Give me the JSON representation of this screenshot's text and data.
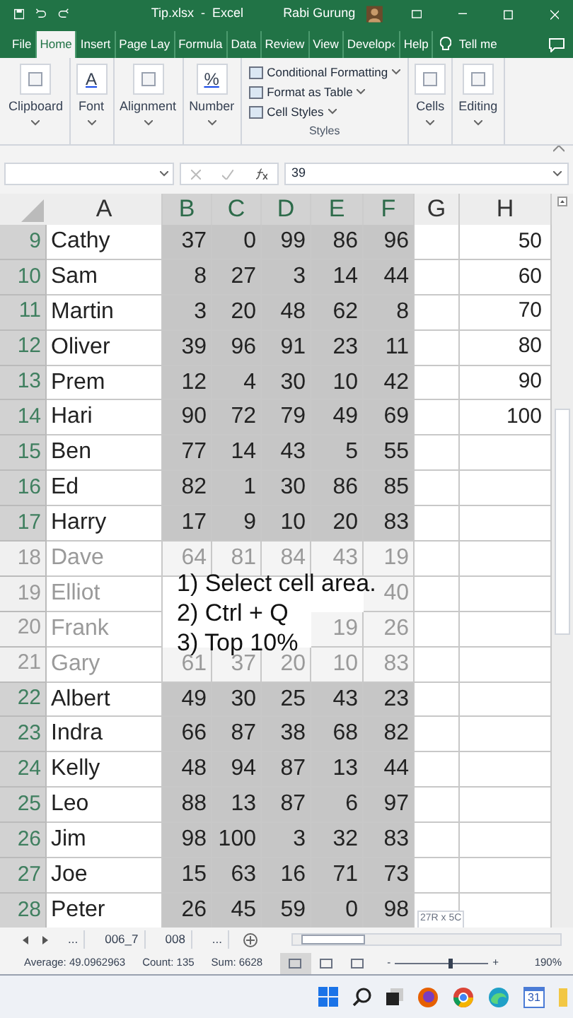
{
  "window": {
    "title": "Tip.xlsx  -  Excel",
    "user": "Rabi Gurung"
  },
  "tabs": [
    {
      "label": "File",
      "selected": false
    },
    {
      "label": "Home",
      "selected": true
    },
    {
      "label": "Insert",
      "selected": false
    },
    {
      "label": "Page Lay",
      "selected": false
    },
    {
      "label": "Formula",
      "selected": false
    },
    {
      "label": "Data",
      "selected": false
    },
    {
      "label": "Review",
      "selected": false
    },
    {
      "label": "View",
      "selected": false
    },
    {
      "label": "Develop‹",
      "selected": false
    },
    {
      "label": "Help",
      "selected": false
    }
  ],
  "tell_me": "Tell me",
  "ribbon": {
    "groups": [
      {
        "kind": "button",
        "label": "Clipboard"
      },
      {
        "kind": "button",
        "label": "Font",
        "icon_text": "A"
      },
      {
        "kind": "button",
        "label": "Alignment"
      },
      {
        "kind": "button",
        "label": "Number",
        "icon_text": "%"
      },
      {
        "kind": "styles",
        "label": "Styles",
        "items": [
          "Conditional Formatting",
          "Format as Table",
          "Cell Styles"
        ]
      },
      {
        "kind": "button",
        "label": "Cells"
      },
      {
        "kind": "button",
        "label": "Editing"
      }
    ]
  },
  "formula_bar": {
    "value": "39"
  },
  "columns": [
    {
      "label": "A",
      "selected": false
    },
    {
      "label": "B",
      "selected": true
    },
    {
      "label": "C",
      "selected": true
    },
    {
      "label": "D",
      "selected": true
    },
    {
      "label": "E",
      "selected": true
    },
    {
      "label": "F",
      "selected": true
    },
    {
      "label": "G",
      "selected": false
    },
    {
      "label": "H",
      "selected": false
    }
  ],
  "rows": [
    {
      "num": "9",
      "name": "Cathy",
      "values": [
        "37",
        "0",
        "99",
        "86",
        "96"
      ],
      "h": "50",
      "dimmed": false,
      "selected": true
    },
    {
      "num": "10",
      "name": "Sam",
      "values": [
        "8",
        "27",
        "3",
        "14",
        "44"
      ],
      "h": "60",
      "dimmed": false,
      "selected": true
    },
    {
      "num": "11",
      "name": "Martin",
      "values": [
        "3",
        "20",
        "48",
        "62",
        "8"
      ],
      "h": "70",
      "dimmed": false,
      "selected": true
    },
    {
      "num": "12",
      "name": "Oliver",
      "values": [
        "39",
        "96",
        "91",
        "23",
        "11"
      ],
      "h": "80",
      "dimmed": false,
      "selected": true
    },
    {
      "num": "13",
      "name": "Prem",
      "values": [
        "12",
        "4",
        "30",
        "10",
        "42"
      ],
      "h": "90",
      "dimmed": false,
      "selected": true
    },
    {
      "num": "14",
      "name": "Hari",
      "values": [
        "90",
        "72",
        "79",
        "49",
        "69"
      ],
      "h": "100",
      "dimmed": false,
      "selected": true
    },
    {
      "num": "15",
      "name": "Ben",
      "values": [
        "77",
        "14",
        "43",
        "5",
        "55"
      ],
      "dimmed": false,
      "selected": true
    },
    {
      "num": "16",
      "name": "Ed",
      "values": [
        "82",
        "1",
        "30",
        "86",
        "85"
      ],
      "dimmed": false,
      "selected": true
    },
    {
      "num": "17",
      "name": "Harry",
      "values": [
        "17",
        "9",
        "10",
        "20",
        "83"
      ],
      "dimmed": false,
      "selected": true
    },
    {
      "num": "18",
      "name": "Dave",
      "values": [
        "64",
        "81",
        "84",
        "43",
        "19"
      ],
      "dimmed": true,
      "selected": true
    },
    {
      "num": "19",
      "name": "Elliot",
      "values": [
        "40"
      ],
      "dimmed": true,
      "selected": true
    },
    {
      "num": "20",
      "name": "Frank",
      "values": [
        "19",
        "26"
      ],
      "dimmed": true,
      "selected": true
    },
    {
      "num": "21",
      "name": "Gary",
      "values": [
        "61",
        "37",
        "20",
        "10",
        "83"
      ],
      "dimmed": true,
      "selected": true
    },
    {
      "num": "22",
      "name": "Albert",
      "values": [
        "49",
        "30",
        "25",
        "43",
        "23"
      ],
      "dimmed": false,
      "selected": true
    },
    {
      "num": "23",
      "name": "Indra",
      "values": [
        "66",
        "87",
        "38",
        "68",
        "82"
      ],
      "dimmed": false,
      "selected": true
    },
    {
      "num": "24",
      "name": "Kelly",
      "values": [
        "48",
        "94",
        "87",
        "13",
        "44"
      ],
      "dimmed": false,
      "selected": true
    },
    {
      "num": "25",
      "name": "Leo",
      "values": [
        "88",
        "13",
        "87",
        "6",
        "97"
      ],
      "dimmed": false,
      "selected": true
    },
    {
      "num": "26",
      "name": "Jim",
      "values": [
        "98",
        "100",
        "3",
        "32",
        "83"
      ],
      "dimmed": false,
      "selected": true
    },
    {
      "num": "27",
      "name": "Joe",
      "values": [
        "15",
        "63",
        "16",
        "71",
        "73"
      ],
      "dimmed": false,
      "selected": true
    },
    {
      "num": "28",
      "name": "Peter",
      "values": [
        "26",
        "45",
        "59",
        "0",
        "98"
      ],
      "dimmed": false,
      "selected": true
    }
  ],
  "instructions": [
    "1) Select cell area.",
    "2) Ctrl + Q",
    "3) Top 10%"
  ],
  "selection_tooltip": "27R x 5C",
  "sheet_tabs": [
    {
      "label": "...",
      "selected": false
    },
    {
      "label": "006_7",
      "selected": false
    },
    {
      "label": "008",
      "selected": false
    },
    {
      "label": "...",
      "selected": false
    }
  ],
  "status_bar": {
    "stats": [
      "Average: 49.0962963",
      "Count: 135",
      "Sum: 6628"
    ],
    "views": [
      {
        "selected": true
      },
      {
        "selected": false
      },
      {
        "selected": false
      }
    ],
    "zoom_minus": "-",
    "zoom_plus": "+",
    "zoom": {
      "level": 0.6
    },
    "zoom_label": "190%"
  },
  "taskbar": {
    "calendar": "31"
  }
}
